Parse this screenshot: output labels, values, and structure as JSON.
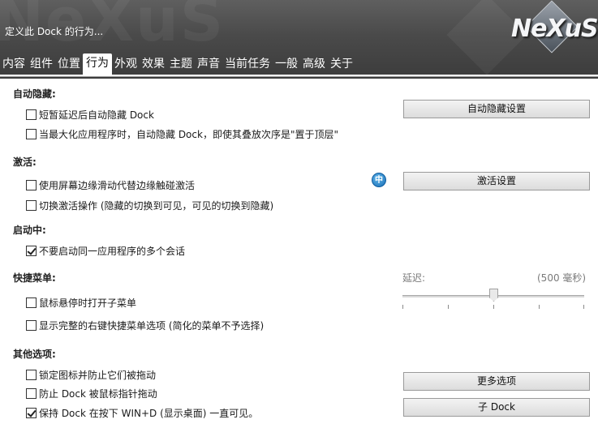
{
  "window": {
    "title": "定义此 Dock 的行为...",
    "watermark": "NeXuS",
    "logo_text": "NeXuS"
  },
  "tabs": [
    {
      "label": "内容",
      "active": false
    },
    {
      "label": "组件",
      "active": false
    },
    {
      "label": "位置",
      "active": false
    },
    {
      "label": "行为",
      "active": true
    },
    {
      "label": "外观",
      "active": false
    },
    {
      "label": "效果",
      "active": false
    },
    {
      "label": "主题",
      "active": false
    },
    {
      "label": "声音",
      "active": false
    },
    {
      "label": "当前任务",
      "active": false
    },
    {
      "label": "一般",
      "active": false
    },
    {
      "label": "高级",
      "active": false
    },
    {
      "label": "关于",
      "active": false
    }
  ],
  "sections": {
    "autohide": {
      "title": "自动隐藏:",
      "options": [
        {
          "label": "短暂延迟后自动隐藏 Dock",
          "checked": false
        },
        {
          "label": "当最大化应用程序时，自动隐藏 Dock，即使其叠放次序是\"置于顶层\"",
          "checked": false
        }
      ],
      "button": "自动隐藏设置"
    },
    "activation": {
      "title": "激活:",
      "options": [
        {
          "label": "使用屏幕边缘滑动代替边缘触碰激活",
          "checked": false
        },
        {
          "label": "切换激活操作 (隐藏的切换到可见，可见的切换到隐藏)",
          "checked": false
        }
      ],
      "button": "激活设置",
      "badge": "中"
    },
    "startup": {
      "title": "启动中:",
      "options": [
        {
          "label": "不要启动同一应用程序的多个会话",
          "checked": true
        }
      ]
    },
    "shortcut_menu": {
      "title": "快捷菜单:",
      "options": [
        {
          "label": "鼠标悬停时打开子菜单",
          "checked": false
        },
        {
          "label": "显示完整的右键快捷菜单选项 (简化的菜单不予选择)",
          "checked": false
        }
      ],
      "delay_label": "延迟:",
      "delay_value": "(500 毫秒)",
      "slider_fraction": 0.5
    },
    "other": {
      "title": "其他选项:",
      "options": [
        {
          "label": "锁定图标并防止它们被拖动",
          "checked": false
        },
        {
          "label": "防止 Dock 被鼠标指针拖动",
          "checked": false
        },
        {
          "label": "保持 Dock 在按下 WIN+D (显示桌面) 一直可见。",
          "checked": true
        }
      ],
      "buttons": [
        "更多选项",
        "子 Dock"
      ]
    }
  }
}
